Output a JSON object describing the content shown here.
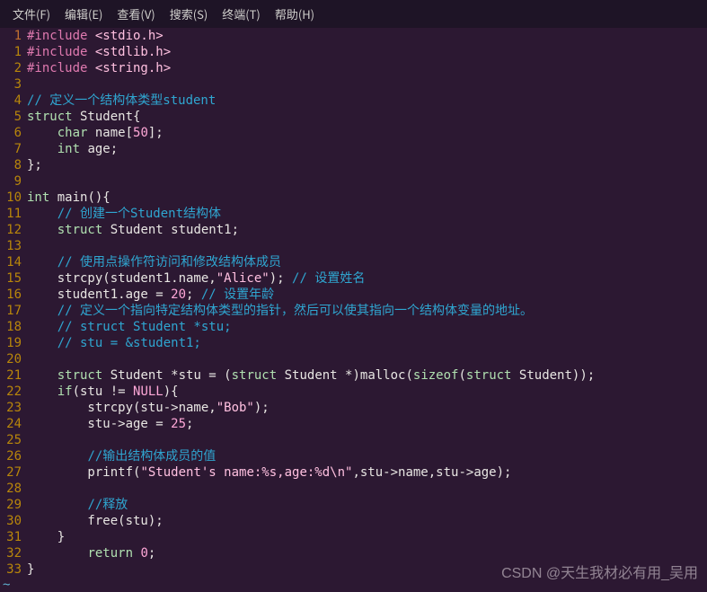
{
  "menu": {
    "file": "文件(F)",
    "edit": "编辑(E)",
    "view": "查看(V)",
    "search": "搜索(S)",
    "terminal": "终端(T)",
    "help": "帮助(H)"
  },
  "gutter_current": "1",
  "lines": [
    {
      "n": "1",
      "t": [
        {
          "c": "inc",
          "s": "#include "
        },
        {
          "c": "str",
          "s": "<stdio.h>"
        }
      ]
    },
    {
      "n": "1",
      "t": [
        {
          "c": "inc",
          "s": "#include "
        },
        {
          "c": "str",
          "s": "<stdlib.h>"
        }
      ]
    },
    {
      "n": "2",
      "t": [
        {
          "c": "inc",
          "s": "#include "
        },
        {
          "c": "str",
          "s": "<string.h>"
        }
      ]
    },
    {
      "n": "3",
      "t": []
    },
    {
      "n": "4",
      "t": [
        {
          "c": "cmt",
          "s": "// 定义一个结构体类型student"
        }
      ]
    },
    {
      "n": "5",
      "t": [
        {
          "c": "kw",
          "s": "struct"
        },
        {
          "c": "id",
          "s": " Student{"
        }
      ]
    },
    {
      "n": "6",
      "t": [
        {
          "c": "id",
          "s": "    "
        },
        {
          "c": "type",
          "s": "char"
        },
        {
          "c": "id",
          "s": " name["
        },
        {
          "c": "num",
          "s": "50"
        },
        {
          "c": "id",
          "s": "];"
        }
      ]
    },
    {
      "n": "7",
      "t": [
        {
          "c": "id",
          "s": "    "
        },
        {
          "c": "type",
          "s": "int"
        },
        {
          "c": "id",
          "s": " age;"
        }
      ]
    },
    {
      "n": "8",
      "t": [
        {
          "c": "id",
          "s": "};"
        }
      ]
    },
    {
      "n": "9",
      "t": []
    },
    {
      "n": "10",
      "t": [
        {
          "c": "type",
          "s": "int"
        },
        {
          "c": "id",
          "s": " main(){"
        }
      ]
    },
    {
      "n": "11",
      "t": [
        {
          "c": "id",
          "s": "    "
        },
        {
          "c": "cmt",
          "s": "// 创建一个Student结构体"
        }
      ]
    },
    {
      "n": "12",
      "t": [
        {
          "c": "id",
          "s": "    "
        },
        {
          "c": "kw",
          "s": "struct"
        },
        {
          "c": "id",
          "s": " Student student1;"
        }
      ]
    },
    {
      "n": "13",
      "t": []
    },
    {
      "n": "14",
      "t": [
        {
          "c": "id",
          "s": "    "
        },
        {
          "c": "cmt",
          "s": "// 使用点操作符访问和修改结构体成员"
        }
      ]
    },
    {
      "n": "15",
      "t": [
        {
          "c": "id",
          "s": "    strcpy(student1.name,"
        },
        {
          "c": "str",
          "s": "\"Alice\""
        },
        {
          "c": "id",
          "s": "); "
        },
        {
          "c": "cmt",
          "s": "// 设置姓名"
        }
      ]
    },
    {
      "n": "16",
      "t": [
        {
          "c": "id",
          "s": "    student1.age = "
        },
        {
          "c": "num",
          "s": "20"
        },
        {
          "c": "id",
          "s": "; "
        },
        {
          "c": "cmt",
          "s": "// 设置年龄"
        }
      ]
    },
    {
      "n": "17",
      "t": [
        {
          "c": "id",
          "s": "    "
        },
        {
          "c": "cmt",
          "s": "// 定义一个指向特定结构体类型的指针，然后可以使其指向一个结构体变量的地址。"
        }
      ]
    },
    {
      "n": "18",
      "t": [
        {
          "c": "id",
          "s": "    "
        },
        {
          "c": "cmt",
          "s": "// struct Student *stu;"
        }
      ]
    },
    {
      "n": "19",
      "t": [
        {
          "c": "id",
          "s": "    "
        },
        {
          "c": "cmt",
          "s": "// stu = &student1;"
        }
      ]
    },
    {
      "n": "20",
      "t": []
    },
    {
      "n": "21",
      "t": [
        {
          "c": "id",
          "s": "    "
        },
        {
          "c": "kw",
          "s": "struct"
        },
        {
          "c": "id",
          "s": " Student *stu = ("
        },
        {
          "c": "kw",
          "s": "struct"
        },
        {
          "c": "id",
          "s": " Student *)malloc("
        },
        {
          "c": "kw",
          "s": "sizeof"
        },
        {
          "c": "id",
          "s": "("
        },
        {
          "c": "kw",
          "s": "struct"
        },
        {
          "c": "id",
          "s": " Student));"
        }
      ]
    },
    {
      "n": "22",
      "t": [
        {
          "c": "id",
          "s": "    "
        },
        {
          "c": "kw",
          "s": "if"
        },
        {
          "c": "id",
          "s": "(stu != "
        },
        {
          "c": "num",
          "s": "NULL"
        },
        {
          "c": "id",
          "s": "){"
        }
      ]
    },
    {
      "n": "23",
      "t": [
        {
          "c": "id",
          "s": "        strcpy(stu->name,"
        },
        {
          "c": "str",
          "s": "\"Bob\""
        },
        {
          "c": "id",
          "s": ");"
        }
      ]
    },
    {
      "n": "24",
      "t": [
        {
          "c": "id",
          "s": "        stu->age = "
        },
        {
          "c": "num",
          "s": "25"
        },
        {
          "c": "id",
          "s": ";"
        }
      ]
    },
    {
      "n": "25",
      "t": []
    },
    {
      "n": "26",
      "t": [
        {
          "c": "id",
          "s": "        "
        },
        {
          "c": "cmt",
          "s": "//输出结构体成员的值"
        }
      ]
    },
    {
      "n": "27",
      "t": [
        {
          "c": "id",
          "s": "        printf("
        },
        {
          "c": "str",
          "s": "\"Student's name:%s,age:%d\\n\""
        },
        {
          "c": "id",
          "s": ",stu->name,stu->age);"
        }
      ]
    },
    {
      "n": "28",
      "t": []
    },
    {
      "n": "29",
      "t": [
        {
          "c": "id",
          "s": "        "
        },
        {
          "c": "cmt",
          "s": "//释放"
        }
      ]
    },
    {
      "n": "30",
      "t": [
        {
          "c": "id",
          "s": "        free(stu);"
        }
      ]
    },
    {
      "n": "31",
      "t": [
        {
          "c": "id",
          "s": "    }"
        }
      ]
    },
    {
      "n": "32",
      "t": [
        {
          "c": "id",
          "s": "        "
        },
        {
          "c": "kw",
          "s": "return"
        },
        {
          "c": "id",
          "s": " "
        },
        {
          "c": "num",
          "s": "0"
        },
        {
          "c": "id",
          "s": ";"
        }
      ]
    },
    {
      "n": "33",
      "t": [
        {
          "c": "id",
          "s": "}"
        }
      ]
    }
  ],
  "tilde": "~",
  "watermark": "CSDN @天生我材必有用_吴用"
}
